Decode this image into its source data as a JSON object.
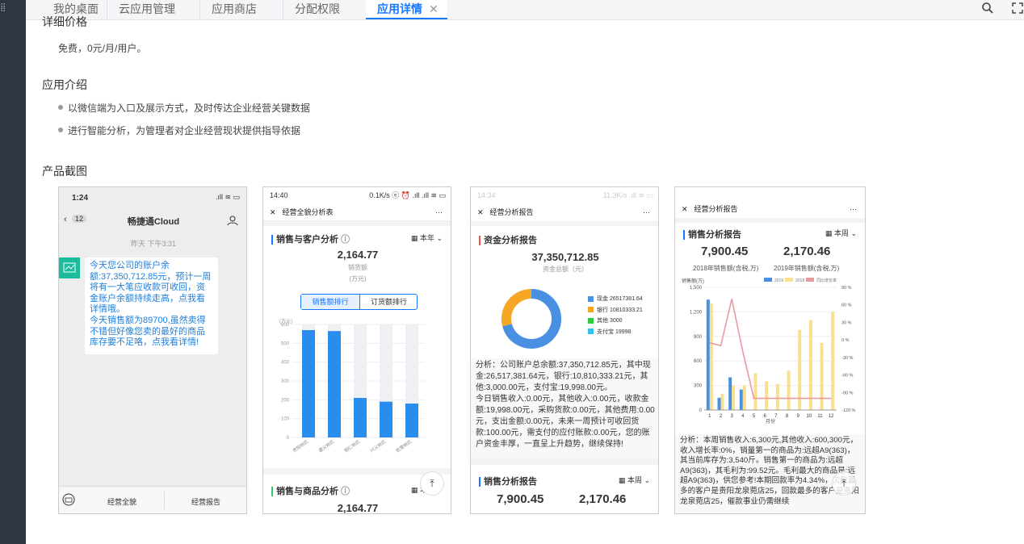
{
  "tabs": [
    {
      "label": "我的桌面"
    },
    {
      "label": "云应用管理"
    },
    {
      "label": "应用商店"
    },
    {
      "label": "分配权限"
    },
    {
      "label": "应用详情",
      "close": "✕"
    }
  ],
  "toolbar": {
    "search_icon": "search-icon",
    "fullscreen_icon": "fullscreen-icon"
  },
  "pricing": {
    "heading": "详细价格",
    "value": "免费，0元/月/用户。"
  },
  "intro": {
    "heading": "应用介绍",
    "bullets": [
      "以微信端为入口及展示方式，及时传达企业经营关键数据",
      "进行智能分析，为管理者对企业经营现状提供指导依据"
    ]
  },
  "screens_heading": "产品截图",
  "shot1": {
    "time": "1:24",
    "back_count": "12",
    "title": "畅捷通Cloud",
    "date": "昨天 下午3:31",
    "msg": "今天您公司的账户余额:37,350,712.85元，预计一周将有一大笔应收款可收回，资金账户余额持续走高，点我看详情哦。\n今天销售额为89700,虽然卖得不错但好像您卖的最好的商品库存要不足咯，点我看详情!",
    "tab1": "经营全貌",
    "tab2": "经营报告"
  },
  "shot2": {
    "time": "14:40",
    "status_right": "0.1K/s ⓔ ⏰ .ıll .ıll ≋ ▭",
    "title": "经营全貌分析表",
    "card_title": "销售与客户分析",
    "period": "本年",
    "big": "2,164.77",
    "big_label": "销货额",
    "unit": "(万元)",
    "tab_a": "销售额排行",
    "tab_b": "订货额排行",
    "y_unit": "(万元)",
    "card2_title": "销售与商品分析",
    "big2": "2,164.77"
  },
  "shot3": {
    "time": "14:34",
    "status_right": "11.3K/s .ıll ≋ ▭",
    "title": "经营分析报告",
    "card_title": "资金分析报告",
    "big": "37,350,712.85",
    "big_label": "资金总额（元）",
    "legend": [
      {
        "name": "现金",
        "value": "26517381.64",
        "color": "#4a90e2"
      },
      {
        "name": "银行",
        "value": "10810333.21",
        "color": "#f5a623"
      },
      {
        "name": "其他",
        "value": "3000",
        "color": "#2ecc40"
      },
      {
        "name": "支付宝",
        "value": "19998",
        "color": "#33c3f0"
      }
    ],
    "analysis": "分析：公司账户总余额:37,350,712.85元，其中现金:26,517,381.64元，银行:10,810,333.21元，其他:3,000.00元，支付宝:19,998.00元。\n今日销售收入:0.00元，其他收入:0.00元，收款金额:19,998.00元，采购货款:0.00元，其他费用:0.00元，支出金额:0.00元，未来一周预计可收回货款:100.00元，需支付的应付账款:0.00元，您的账户资金丰厚，一直呈上升趋势，继续保持!",
    "card2_title": "销售分析报告",
    "period": "本周",
    "big_a": "7,900.45",
    "big_b": "2,170.46"
  },
  "shot4": {
    "title": "经营分析报告",
    "card_title": "销售分析报告",
    "period": "本周",
    "big_a": "7,900.45",
    "big_b": "2,170.46",
    "label_a": "2018年销售额(含税,万)",
    "label_b": "2019年销售额(含税,万)",
    "y_left_title": "销售额(万)",
    "legend": [
      "2019",
      "2018",
      "同比增长率"
    ],
    "x_title": "月份",
    "analysis": "分析：本周销售收入:6,300元,其他收入:600,300元，收入增长率:0%，销量第一的商品为:远超A9(363)，其当前库存为:3,540斤。销售第一的商品为:远超A9(363)，其毛利为:99.52元。毛利最大的商品是:远超A9(363)，供您参考!本期回款率为4.34%，欠款最多的客户是贵阳龙泉菀店25，回款最多的客户是贵阳龙泉菀店25，催款事业仍需继续"
  },
  "chart_data": [
    {
      "type": "bar",
      "title": "",
      "ylabel": "(万元)",
      "ylim": [
        0,
        600
      ],
      "categories": [
        "贵阳地区",
        "遵义地区",
        "铜仁地区",
        "兴义地区",
        "凯里地区"
      ],
      "values": [
        570,
        565,
        210,
        190,
        180
      ]
    },
    {
      "type": "pie",
      "title": "",
      "categories": [
        "现金",
        "银行",
        "其他",
        "支付宝"
      ],
      "values": [
        26517381.64,
        10810333.21,
        3000,
        19998
      ]
    },
    {
      "type": "bar",
      "title": "",
      "xlabel": "月份",
      "ylabel": "销售额(万)",
      "ylim": [
        0,
        1500
      ],
      "y2lim": [
        -120,
        90
      ],
      "categories": [
        "1",
        "2",
        "3",
        "4",
        "5",
        "6",
        "7",
        "8",
        "9",
        "10",
        "11",
        "12"
      ],
      "series": [
        {
          "name": "2019",
          "values": [
            1350,
            150,
            400,
            250,
            0,
            0,
            0,
            0,
            0,
            0,
            0,
            0
          ]
        },
        {
          "name": "2018",
          "values": [
            1300,
            200,
            300,
            300,
            450,
            350,
            320,
            480,
            980,
            1100,
            820,
            1200
          ]
        },
        {
          "name": "同比增长率",
          "values": [
            -5,
            -10,
            70,
            -20,
            -100,
            -100,
            -100,
            -100,
            -100,
            -100,
            -100,
            -100
          ]
        }
      ]
    }
  ]
}
